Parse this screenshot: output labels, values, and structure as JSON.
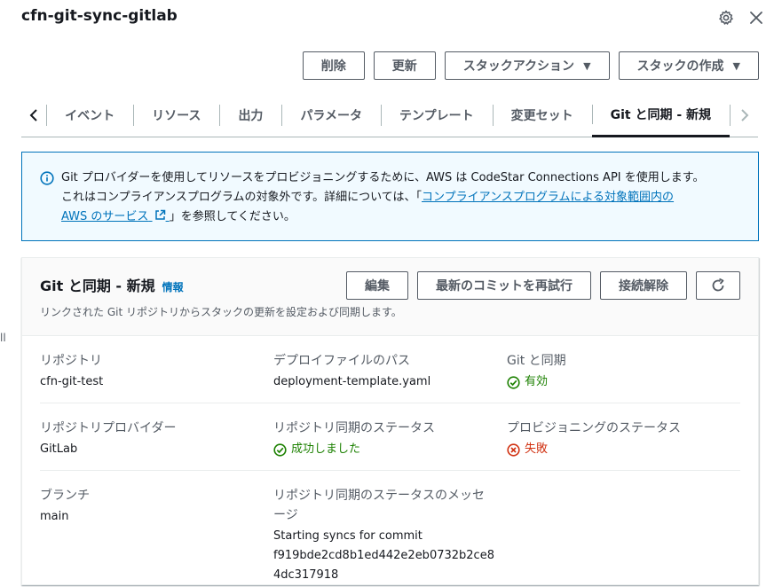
{
  "title": "cfn-git-sync-gitlab",
  "header_actions": {
    "delete_label": "削除",
    "update_label": "更新",
    "stack_actions_label": "スタックアクション",
    "create_stack_label": "スタックの作成"
  },
  "tabs": [
    {
      "label": "イベント"
    },
    {
      "label": "リソース"
    },
    {
      "label": "出力"
    },
    {
      "label": "パラメータ"
    },
    {
      "label": "テンプレート"
    },
    {
      "label": "変更セット"
    },
    {
      "label": "Git と同期 - 新規",
      "active": true
    }
  ],
  "info_box": {
    "line1": "Git プロバイダーを使用してリソースをプロビジョニングするために、AWS は CodeStar Connections API を使用します。",
    "line2_prefix": "これはコンプライアンスプログラムの対象外です。詳細については、「",
    "link_text_1": "コンプライアンスプログラムによる対象範囲内の",
    "link_text_2": "AWS のサービス",
    "line3_suffix": "」を参照してください。"
  },
  "panel": {
    "title": "Git と同期 - 新規",
    "info_link": "情報",
    "description": "リンクされた Git リポジトリからスタックの更新を設定および同期します。",
    "edit_label": "編集",
    "retry_label": "最新のコミットを再試行",
    "disconnect_label": "接続解除",
    "fields": {
      "repository_label": "リポジトリ",
      "repository_value": "cfn-git-test",
      "deploy_path_label": "デプロイファイルのパス",
      "deploy_path_value": "deployment-template.yaml",
      "git_sync_label": "Git と同期",
      "git_sync_value": "有効",
      "provider_label": "リポジトリプロバイダー",
      "provider_value": "GitLab",
      "repo_sync_status_label": "リポジトリ同期のステータス",
      "repo_sync_status_value": "成功しました",
      "provisioning_status_label": "プロビジョニングのステータス",
      "provisioning_status_value": "失敗",
      "branch_label": "ブランチ",
      "branch_value": "main",
      "sync_message_label": "リポジトリ同期のステータスのメッセージ",
      "sync_message_line1": "Starting syncs for commit",
      "sync_message_line2": "f919bde2cd8b1ed442e2eb0732b2ce84dc317918"
    }
  },
  "colors": {
    "success": "#1d8102",
    "error": "#d13212",
    "link": "#0073bb",
    "info_bg": "#f1faff"
  }
}
